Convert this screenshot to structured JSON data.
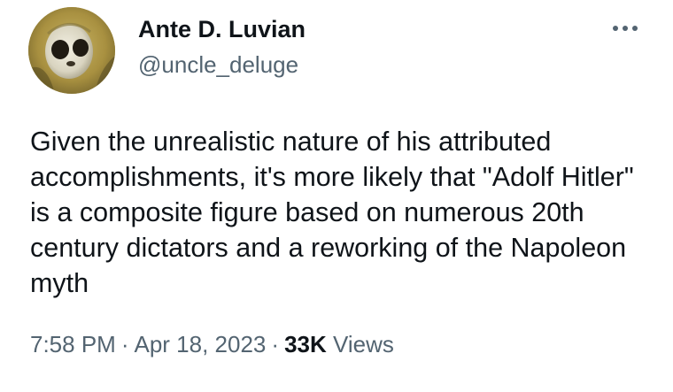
{
  "tweet": {
    "author": {
      "display_name": "Ante D. Luvian",
      "handle": "@uncle_deluge",
      "avatar_icon": "profile-avatar"
    },
    "more_icon": "more-horizontal-icon",
    "text": "Given the unrealistic nature of his attributed accomplishments, it's more likely that \"Adolf Hitler\" is a composite figure based on numerous 20th century dictators and a reworking of the Napoleon myth",
    "time": "7:58 PM",
    "separator": "·",
    "date": "Apr 18, 2023",
    "views_count": "33K",
    "views_label": "Views"
  },
  "colors": {
    "text_primary": "#0f1419",
    "text_secondary": "#536471",
    "background": "#ffffff"
  }
}
